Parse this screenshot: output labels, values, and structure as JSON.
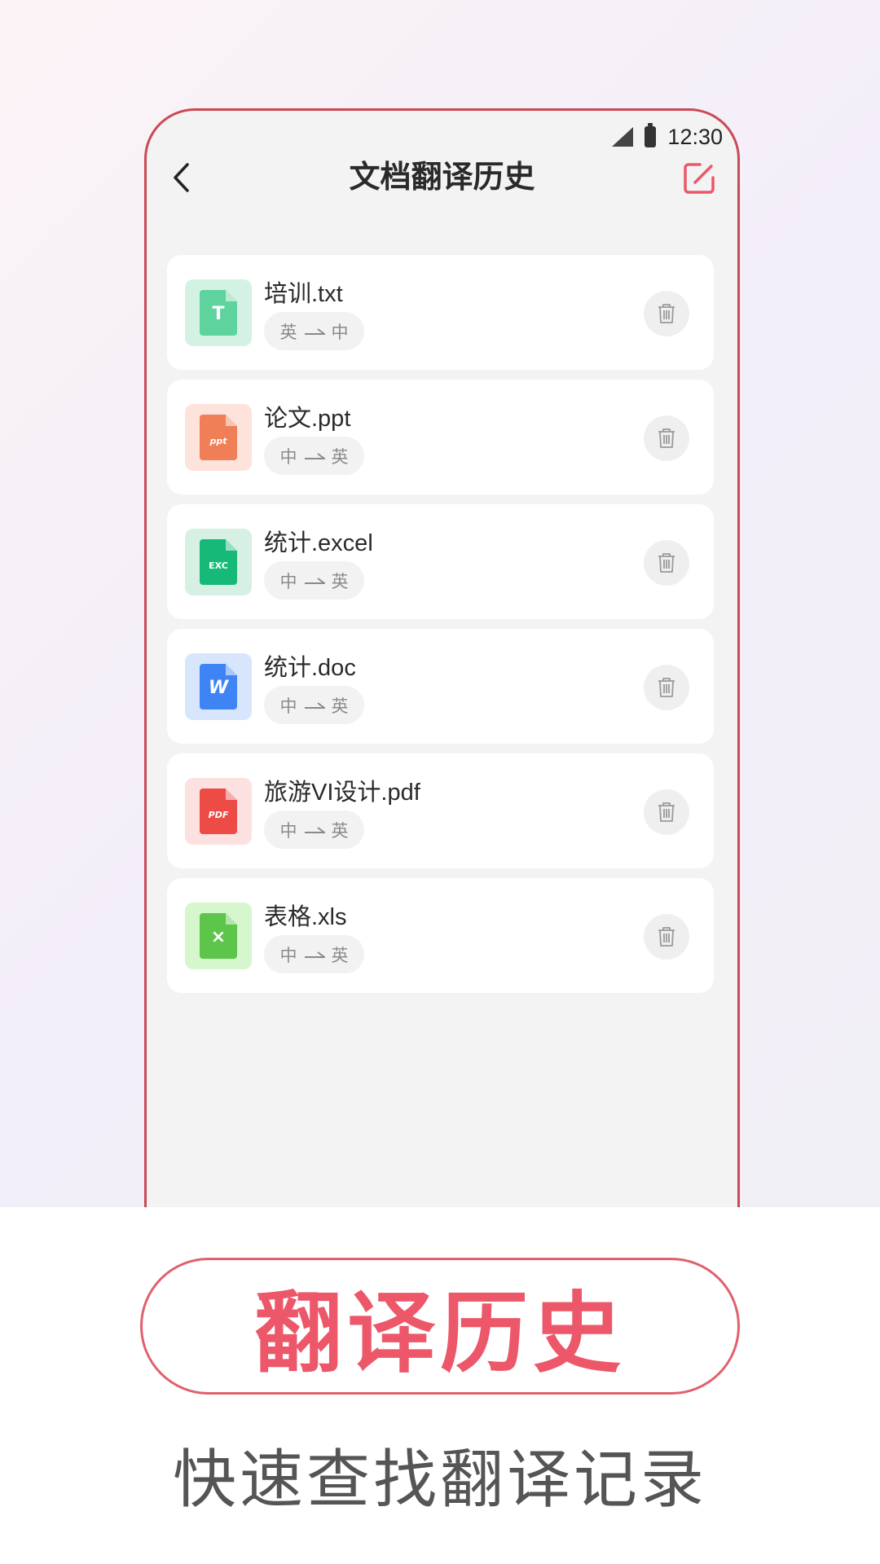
{
  "status_bar": {
    "time": "12:30"
  },
  "nav": {
    "title": "文档翻译历史"
  },
  "files": [
    {
      "name": "培训.txt",
      "from": "英",
      "to": "中",
      "icon": "txt-file-icon",
      "icon_bg": "#d4f2e4",
      "icon_color": "#5fd39d",
      "icon_glyph": "T"
    },
    {
      "name": "论文.ppt",
      "from": "中",
      "to": "英",
      "icon": "ppt-file-icon",
      "icon_bg": "#fde3dc",
      "icon_color": "#f07e57",
      "icon_glyph": "ppt"
    },
    {
      "name": "统计.excel",
      "from": "中",
      "to": "英",
      "icon": "excel-file-icon",
      "icon_bg": "#d7f0e4",
      "icon_color": "#17b978",
      "icon_glyph": "EXC"
    },
    {
      "name": "统计.doc",
      "from": "中",
      "to": "英",
      "icon": "doc-file-icon",
      "icon_bg": "#d8e6fd",
      "icon_color": "#3f84f5",
      "icon_glyph": "W"
    },
    {
      "name": "旅游VI设计.pdf",
      "from": "中",
      "to": "英",
      "icon": "pdf-file-icon",
      "icon_bg": "#fde0e0",
      "icon_color": "#ec4c45",
      "icon_glyph": "PDF"
    },
    {
      "name": "表格.xls",
      "from": "中",
      "to": "英",
      "icon": "xls-file-icon",
      "icon_bg": "#d6f7cd",
      "icon_color": "#5cc54a",
      "icon_glyph": "×"
    }
  ],
  "promo": {
    "title": "翻译历史",
    "subtitle": "快速查找翻译记录"
  },
  "colors": {
    "accent": "#ec5769",
    "frame": "#c94a55"
  }
}
